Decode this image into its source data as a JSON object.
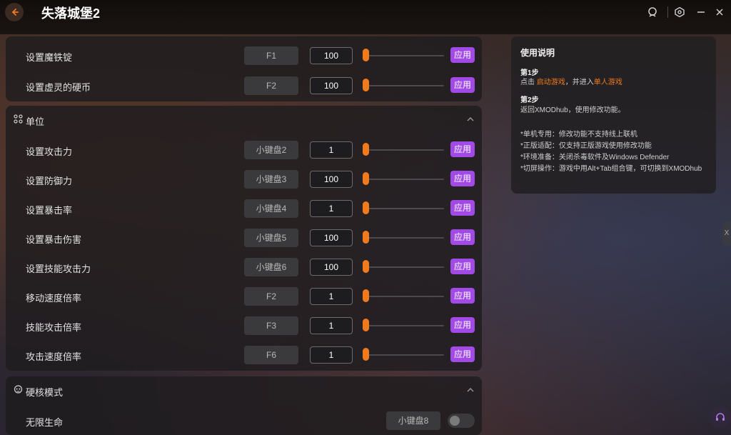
{
  "app": {
    "title": "失落城堡2"
  },
  "colors": {
    "accent": "#a24ae6",
    "slider": "#f07a1c",
    "highlight": "#f07a1c"
  },
  "icons": {
    "back": "back-arrow-icon",
    "user": "user-icon",
    "settings": "cube-settings-icon",
    "minimize": "minimize-icon",
    "close": "close-icon",
    "collapse": "chevron-up-icon",
    "unit": "unit-icon",
    "hardcore": "skull-icon",
    "help": "headset-icon"
  },
  "top_section": {
    "rows": [
      {
        "label": "设置魔铁锭",
        "hotkey": "F1",
        "value": "100",
        "apply": "应用"
      },
      {
        "label": "设置虚灵的硬币",
        "hotkey": "F2",
        "value": "100",
        "apply": "应用"
      }
    ]
  },
  "unit_section": {
    "title": "单位",
    "rows": [
      {
        "label": "设置攻击力",
        "hotkey": "小键盘2",
        "value": "1",
        "apply": "应用"
      },
      {
        "label": "设置防御力",
        "hotkey": "小键盘3",
        "value": "100",
        "apply": "应用"
      },
      {
        "label": "设置暴击率",
        "hotkey": "小键盘4",
        "value": "1",
        "apply": "应用"
      },
      {
        "label": "设置暴击伤害",
        "hotkey": "小键盘5",
        "value": "100",
        "apply": "应用"
      },
      {
        "label": "设置技能攻击力",
        "hotkey": "小键盘6",
        "value": "100",
        "apply": "应用"
      },
      {
        "label": "移动速度倍率",
        "hotkey": "F2",
        "value": "1",
        "apply": "应用"
      },
      {
        "label": "技能攻击倍率",
        "hotkey": "F3",
        "value": "1",
        "apply": "应用"
      },
      {
        "label": "攻击速度倍率",
        "hotkey": "F6",
        "value": "1",
        "apply": "应用"
      }
    ]
  },
  "hardcore_section": {
    "title": "硬核模式",
    "rows": [
      {
        "label": "无限生命",
        "hotkey": "小键盘8",
        "enabled": false
      }
    ]
  },
  "instructions": {
    "title": "使用说明",
    "step1_title": "第1步",
    "step1_prefix": "点击",
    "step1_link1": "启动游戏",
    "step1_mid": "，并进入",
    "step1_link2": "单人游戏",
    "step2_title": "第2步",
    "step2_text": "返回XMODhub，使用修改功能。",
    "notes": [
      "*单机专用：修改功能不支持线上联机",
      "*正版适配：仅支持正版游戏使用修改功能",
      "*环境准备：关闭杀毒软件及Windows Defender",
      "*切屏操作：游戏中用Alt+Tab组合键，可切换到XMODhub"
    ]
  },
  "side_tab": {
    "label": "X"
  }
}
